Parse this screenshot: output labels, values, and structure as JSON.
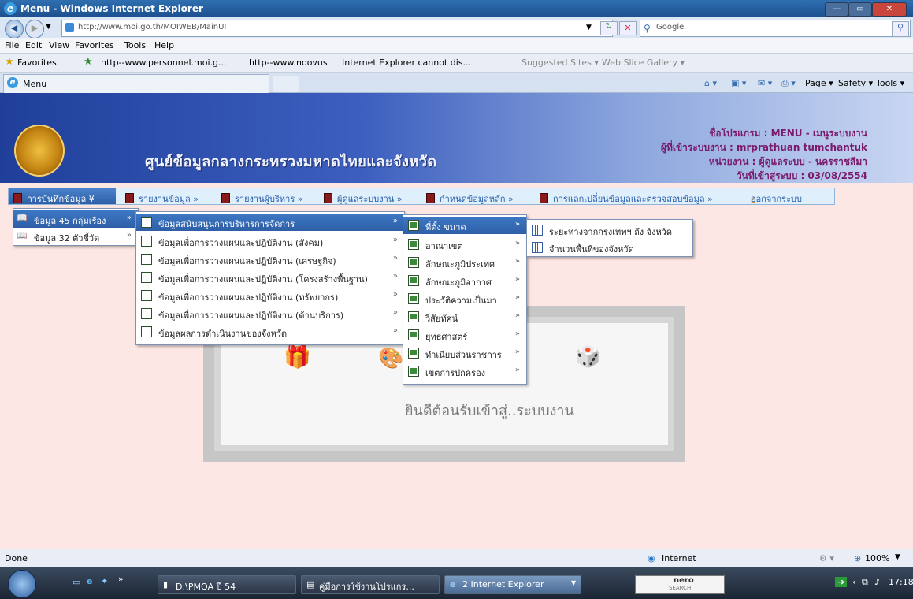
{
  "window": {
    "title": "Menu - Windows Internet Explorer"
  },
  "address": {
    "url": "http://www.moi.go.th/MOIWEB/MainUI",
    "search_placeholder": "Google"
  },
  "menubar": [
    "File",
    "Edit",
    "View",
    "Favorites",
    "Tools",
    "Help"
  ],
  "favorites": {
    "label": "Favorites",
    "links": [
      "http--www.personnel.moi.g...",
      "http--www.noovus",
      "Internet Explorer cannot dis...",
      "Suggested Sites ▾",
      "Web Slice Gallery ▾"
    ]
  },
  "tab": {
    "label": "Menu"
  },
  "commandbar": {
    "page": "Page ▾",
    "safety": "Safety ▾",
    "tools": "Tools ▾"
  },
  "banner": {
    "site_name": "ศูนย์ข้อมูลกลางกระทรวงมหาดไทยและจังหวัด",
    "program": "ชื่อโปรแกรม : MENU - เมนูระบบงาน",
    "user": "ผู้ที่เข้าระบบงาน : mrprathuan tumchantuk",
    "unit": "หน่วยงาน : ผู้ดูแลระบบ - นครราชสีมา",
    "login_date": "วันที่เข้าสู่ระบบ : 03/08/2554"
  },
  "nav": [
    "การบันทึกข้อมูล",
    "รายงานข้อมูล",
    "รายงานผู้บริหาร",
    "ผู้ดูแลระบบงาน",
    "กำหนดข้อมูลหลัก",
    "การแลกเปลี่ยนข้อมูลและตรวจสอบข้อมูล",
    "ออกจากระบบ"
  ],
  "menu1": [
    "ข้อมูล 45 กลุ่มเรื่อง",
    "ข้อมูล 32 ตัวชี้วัด"
  ],
  "menu2": [
    "ข้อมูลสนับสนุนการบริหารการจัดการ",
    "ข้อมูลเพื่อการวางแผนและปฏิบัติงาน (สังคม)",
    "ข้อมูลเพื่อการวางแผนและปฏิบัติงาน (เศรษฐกิจ)",
    "ข้อมูลเพื่อการวางแผนและปฏิบัติงาน (โครงสร้างพื้นฐาน)",
    "ข้อมูลเพื่อการวางแผนและปฏิบัติงาน (ทรัพยากร)",
    "ข้อมูลเพื่อการวางแผนและปฏิบัติงาน (ด้านบริการ)",
    "ข้อมูลผลการดำเนินงานของจังหวัด"
  ],
  "menu3": [
    "ที่ตั้ง ขนาด",
    "อาณาเขต",
    "ลักษณะภูมิประเทศ",
    "ลักษณะภูมิอากาศ",
    "ประวัติความเป็นมา",
    "วิสัยทัศน์",
    "ยุทธศาสตร์",
    "ทำเนียบส่วนราชการ",
    "เขตการปกครอง"
  ],
  "menu4": [
    "ระยะทางจากกรุงเทพฯ ถึง จังหวัด",
    "จำนวนพื้นที่ของจังหวัด"
  ],
  "welcome": {
    "text": "ยินดีต้อนรับเข้าสู่..ระบบงาน"
  },
  "status": {
    "left": "Done",
    "zone": "Internet",
    "zoom": "100%"
  },
  "taskbar": {
    "item1": "D:\\PMQA ปี 54",
    "item2": "คู่มือการใช้งานโปรแกร...",
    "item3": "2 Internet Explorer",
    "search_brand": "nero",
    "search_sub": "SEARCH",
    "clock": "17:18"
  },
  "colors": {
    "accent": "#2e5fa6",
    "page_bg": "#fde7e4",
    "nav_text": "#2a5faa"
  }
}
